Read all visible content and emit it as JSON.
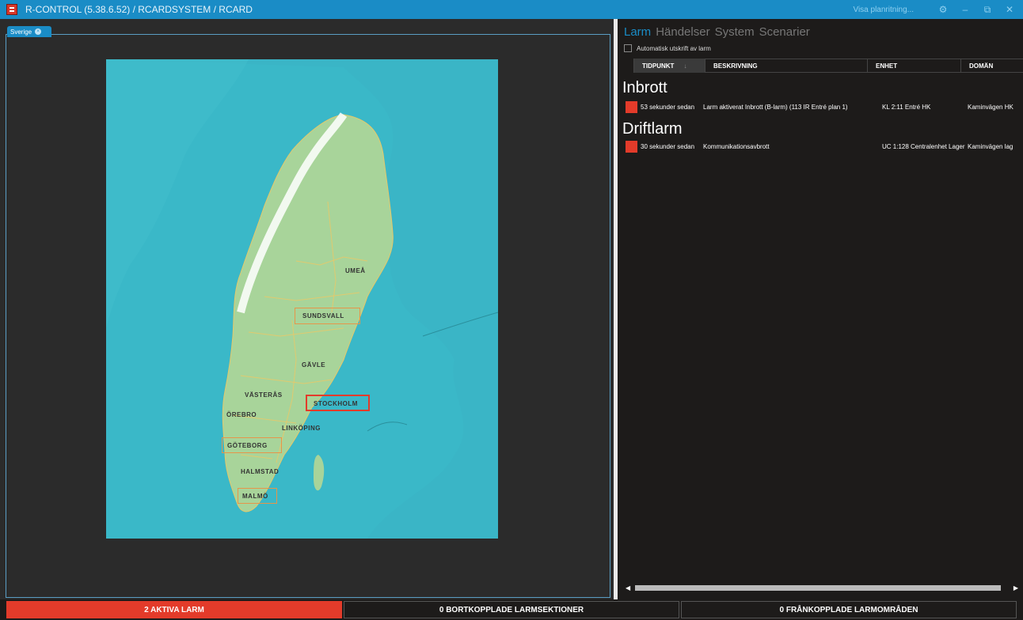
{
  "titlebar": {
    "title": "R-CONTROL (5.38.6.52)  / RCARDSYSTEM / RCARD",
    "plan_link": "Visa planritning...",
    "buttons": {
      "settings": "⚙",
      "minimize": "–",
      "restore": "⧉",
      "close": "✕"
    }
  },
  "left": {
    "tab": {
      "label": "Sverige",
      "close": "×"
    },
    "map": {
      "cities": [
        {
          "name": "UMEÅ",
          "boxed": false,
          "active": false
        },
        {
          "name": "SUNDSVALL",
          "boxed": true,
          "active": false
        },
        {
          "name": "GÄVLE",
          "boxed": false,
          "active": false
        },
        {
          "name": "VÄSTERÅS",
          "boxed": false,
          "active": false
        },
        {
          "name": "STOCKHOLM",
          "boxed": true,
          "active": true
        },
        {
          "name": "ÖREBRO",
          "boxed": false,
          "active": false
        },
        {
          "name": "LINKÖPING",
          "boxed": false,
          "active": false
        },
        {
          "name": "GÖTEBORG",
          "boxed": true,
          "active": false
        },
        {
          "name": "HALMSTAD",
          "boxed": false,
          "active": false
        },
        {
          "name": "MALMÖ",
          "boxed": true,
          "active": false
        }
      ]
    }
  },
  "right": {
    "nav": [
      "Larm",
      "Händelser",
      "System",
      "Scenarier"
    ],
    "nav_active": "Larm",
    "auto_print_label": "Automatisk utskrift av larm",
    "columns": [
      "TIDPUNKT",
      "BESKRIVNING",
      "ENHET",
      "DOMÄN"
    ],
    "groups": [
      {
        "title": "Inbrott",
        "rows": [
          {
            "time": "53 sekunder sedan",
            "description": "Larm aktiverat Inbrott (B-larm) (113 IR Entré plan 1)",
            "unit": "KL 2:11 Entré HK",
            "domain": "Kaminvägen HK"
          }
        ]
      },
      {
        "title": "Driftlarm",
        "rows": [
          {
            "time": "30 sekunder sedan",
            "description": "Kommunikationsavbrott",
            "unit": "UC 1:128 Centralenhet Lager",
            "domain": "Kaminvägen lag"
          }
        ]
      }
    ],
    "scroll_left": "◀",
    "scroll_right": "▶"
  },
  "statusbar": {
    "active_alarms": "2 AKTIVA LARM",
    "disabled_sections": "0 BORTKOPPLADE LARMSEKTIONER",
    "disabled_areas": "0 FRÅNKOPPLADE LARMOMRÅDEN"
  },
  "colors": {
    "accent": "#1a8cc6",
    "alarm": "#e33b2a",
    "sea": "#3ab8c8",
    "land": "#a8d49a",
    "neighbor_land": "#3bb3c4"
  },
  "icons": {
    "app": "app-icon",
    "settings": "gear-icon",
    "sort": "arrow-down-icon"
  }
}
